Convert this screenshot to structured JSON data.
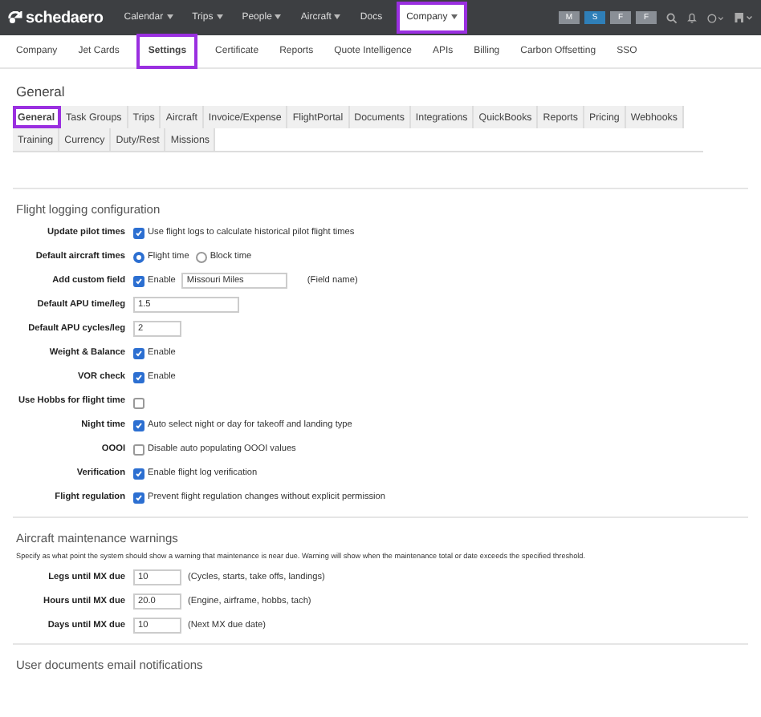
{
  "topnav": {
    "logo": "schedaero",
    "menus": [
      {
        "label": "Calendar",
        "caret": true,
        "highlighted": false
      },
      {
        "label": "Trips",
        "caret": true,
        "highlighted": false
      },
      {
        "label": "People",
        "caret": true,
        "highlighted": false
      },
      {
        "label": "Aircraft",
        "caret": true,
        "highlighted": false
      },
      {
        "label": "Docs",
        "caret": false,
        "highlighted": false
      },
      {
        "label": "Company",
        "caret": true,
        "highlighted": true
      }
    ],
    "badges": [
      {
        "label": "M",
        "color": "#8a8f96"
      },
      {
        "label": "S",
        "color": "#2f7fb8"
      },
      {
        "label": "F",
        "color": "#8a8f96"
      },
      {
        "label": "F",
        "color": "#8a8f96"
      }
    ]
  },
  "subnav": [
    {
      "label": "Company",
      "selected": false,
      "highlighted": false
    },
    {
      "label": "Jet Cards",
      "selected": false,
      "highlighted": false
    },
    {
      "label": "Settings",
      "selected": true,
      "highlighted": true
    },
    {
      "label": "Certificate",
      "selected": false,
      "highlighted": false
    },
    {
      "label": "Reports",
      "selected": false,
      "highlighted": false
    },
    {
      "label": "Quote Intelligence",
      "selected": false,
      "highlighted": false
    },
    {
      "label": "APIs",
      "selected": false,
      "highlighted": false
    },
    {
      "label": "Billing",
      "selected": false,
      "highlighted": false
    },
    {
      "label": "Carbon Offsetting",
      "selected": false,
      "highlighted": false
    },
    {
      "label": "SSO",
      "selected": false,
      "highlighted": false
    }
  ],
  "heading": "General",
  "tabs": [
    {
      "label": "General",
      "selected": true,
      "highlighted": true
    },
    {
      "label": "Task Groups",
      "selected": false,
      "highlighted": false
    },
    {
      "label": "Trips",
      "selected": false,
      "highlighted": false
    },
    {
      "label": "Aircraft",
      "selected": false,
      "highlighted": false
    },
    {
      "label": "Invoice/Expense",
      "selected": false,
      "highlighted": false
    },
    {
      "label": "FlightPortal",
      "selected": false,
      "highlighted": false
    },
    {
      "label": "Documents",
      "selected": false,
      "highlighted": false
    },
    {
      "label": "Integrations",
      "selected": false,
      "highlighted": false
    },
    {
      "label": "QuickBooks",
      "selected": false,
      "highlighted": false
    },
    {
      "label": "Reports",
      "selected": false,
      "highlighted": false
    },
    {
      "label": "Pricing",
      "selected": false,
      "highlighted": false
    },
    {
      "label": "Webhooks",
      "selected": false,
      "highlighted": false
    },
    {
      "label": "Training",
      "selected": false,
      "highlighted": false
    },
    {
      "label": "Currency",
      "selected": false,
      "highlighted": false
    },
    {
      "label": "Duty/Rest",
      "selected": false,
      "highlighted": false
    },
    {
      "label": "Missions",
      "selected": false,
      "highlighted": false
    }
  ],
  "sections": [
    {
      "title": "Flight logging configuration",
      "rows": [
        {
          "label": "Update pilot times",
          "controls": [
            {
              "kind": "check",
              "checked": true,
              "text": "Use flight logs to calculate historical pilot flight times"
            }
          ]
        },
        {
          "label": "Default aircraft times",
          "controls": [
            {
              "kind": "radio",
              "selected": true,
              "text": "Flight time"
            },
            {
              "kind": "radio",
              "selected": false,
              "text": "Block time"
            }
          ]
        },
        {
          "label": "Add custom field",
          "controls": [
            {
              "kind": "check",
              "checked": true,
              "text": "Enable"
            },
            {
              "kind": "wideinput",
              "value": "Missouri Miles"
            },
            {
              "kind": "note",
              "text": "(Field name)"
            }
          ]
        },
        {
          "label": "Default APU time/leg",
          "controls": [
            {
              "kind": "wideinput",
              "value": "1.5"
            }
          ]
        },
        {
          "label": "Default APU cycles/leg",
          "controls": [
            {
              "kind": "input",
              "value": "2"
            }
          ]
        },
        {
          "label": "Weight & Balance",
          "controls": [
            {
              "kind": "check",
              "checked": true,
              "text": "Enable"
            }
          ]
        },
        {
          "label": "VOR check",
          "controls": [
            {
              "kind": "check",
              "checked": true,
              "text": "Enable"
            }
          ]
        },
        {
          "label": "Use Hobbs for flight time",
          "controls": [
            {
              "kind": "check",
              "checked": false
            }
          ]
        },
        {
          "label": "Night time",
          "controls": [
            {
              "kind": "check",
              "checked": true,
              "text": "Auto select night or day for takeoff and landing type"
            }
          ]
        },
        {
          "label": "OOOI",
          "controls": [
            {
              "kind": "check",
              "checked": false,
              "text": "Disable auto populating OOOI values"
            }
          ]
        },
        {
          "label": "Verification",
          "controls": [
            {
              "kind": "check",
              "checked": true,
              "text": "Enable flight log verification"
            }
          ]
        },
        {
          "label": "Flight regulation",
          "controls": [
            {
              "kind": "check",
              "checked": true,
              "text": "Prevent flight regulation changes without explicit permission"
            }
          ]
        }
      ]
    },
    {
      "title": "Aircraft maintenance warnings",
      "description": "Specify as what point the system should show a warning that maintenance is near due. Warning will show when the maintenance total or date exceeds the specified threshold.",
      "rows": [
        {
          "label": "Legs until MX due",
          "controls": [
            {
              "kind": "input",
              "value": "10"
            },
            {
              "kind": "note",
              "text": "(Cycles, starts, take offs, landings)"
            }
          ]
        },
        {
          "label": "Hours until MX due",
          "controls": [
            {
              "kind": "input",
              "value": "20.0"
            },
            {
              "kind": "note",
              "text": "(Engine, airframe, hobbs, tach)"
            }
          ]
        },
        {
          "label": "Days until MX due",
          "controls": [
            {
              "kind": "input",
              "value": "10"
            },
            {
              "kind": "note",
              "text": "(Next MX due date)"
            }
          ]
        }
      ]
    },
    {
      "title": "User documents email notifications"
    }
  ]
}
